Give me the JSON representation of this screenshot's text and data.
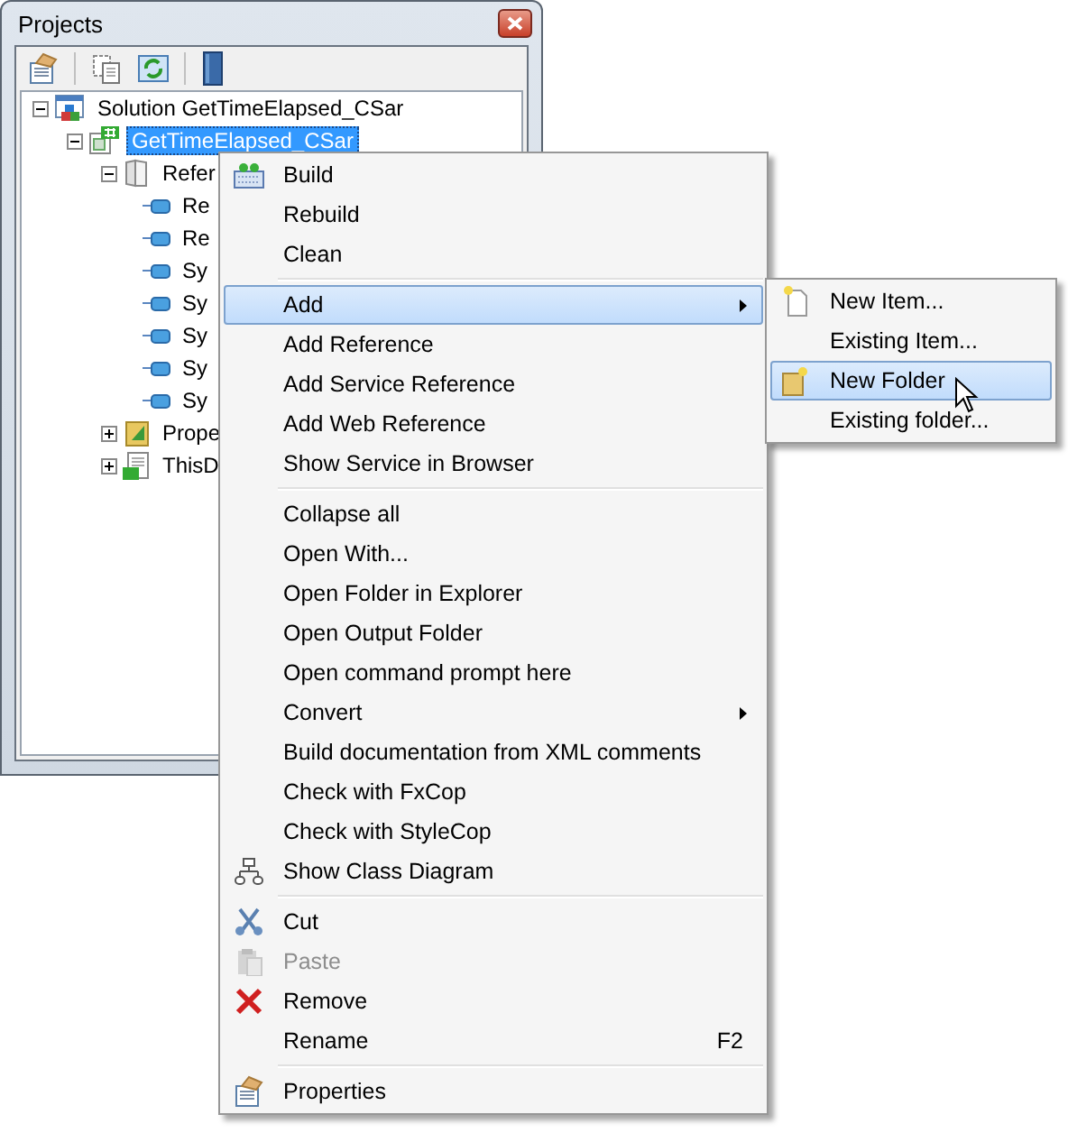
{
  "window": {
    "title": "Projects"
  },
  "tree": [
    {
      "label": "Solution GetTimeElapsed_CSar",
      "kind": "solution",
      "expanded": true,
      "selected": false,
      "children": [
        {
          "label": "GetTimeElapsed_CSar",
          "kind": "project",
          "expanded": true,
          "selected": true,
          "children": [
            {
              "label": "Refer",
              "kind": "references",
              "expanded": true,
              "selected": false,
              "children": [
                {
                  "label": "Re",
                  "kind": "reference",
                  "selected": false
                },
                {
                  "label": "Re",
                  "kind": "reference",
                  "selected": false
                },
                {
                  "label": "Sy",
                  "kind": "reference",
                  "selected": false
                },
                {
                  "label": "Sy",
                  "kind": "reference",
                  "selected": false
                },
                {
                  "label": "Sy",
                  "kind": "reference",
                  "selected": false
                },
                {
                  "label": "Sy",
                  "kind": "reference",
                  "selected": false
                },
                {
                  "label": "Sy",
                  "kind": "reference",
                  "selected": false
                }
              ]
            },
            {
              "label": "Prope",
              "kind": "properties",
              "expanded": false,
              "selected": false
            },
            {
              "label": "ThisD",
              "kind": "file",
              "expanded": false,
              "selected": false
            }
          ]
        }
      ]
    }
  ],
  "context_menu": {
    "items": [
      {
        "kind": "item",
        "label": "Build",
        "selected": false,
        "disabled": false,
        "submenu": false
      },
      {
        "kind": "item",
        "label": "Rebuild",
        "selected": false,
        "disabled": false,
        "submenu": false
      },
      {
        "kind": "item",
        "label": "Clean",
        "selected": false,
        "disabled": false,
        "submenu": false
      },
      {
        "kind": "separator"
      },
      {
        "kind": "item",
        "label": "Add",
        "selected": true,
        "disabled": false,
        "submenu": true
      },
      {
        "kind": "item",
        "label": "Add Reference",
        "selected": false,
        "disabled": false,
        "submenu": false
      },
      {
        "kind": "item",
        "label": "Add Service Reference",
        "selected": false,
        "disabled": false,
        "submenu": false
      },
      {
        "kind": "item",
        "label": "Add Web Reference",
        "selected": false,
        "disabled": false,
        "submenu": false
      },
      {
        "kind": "item",
        "label": "Show Service in Browser",
        "selected": false,
        "disabled": false,
        "submenu": false
      },
      {
        "kind": "separator"
      },
      {
        "kind": "item",
        "label": "Collapse all",
        "selected": false,
        "disabled": false,
        "submenu": false
      },
      {
        "kind": "item",
        "label": "Open With...",
        "selected": false,
        "disabled": false,
        "submenu": false
      },
      {
        "kind": "item",
        "label": "Open Folder in Explorer",
        "selected": false,
        "disabled": false,
        "submenu": false
      },
      {
        "kind": "item",
        "label": "Open Output Folder",
        "selected": false,
        "disabled": false,
        "submenu": false
      },
      {
        "kind": "item",
        "label": "Open command prompt here",
        "selected": false,
        "disabled": false,
        "submenu": false
      },
      {
        "kind": "item",
        "label": "Convert",
        "selected": false,
        "disabled": false,
        "submenu": true
      },
      {
        "kind": "item",
        "label": "Build documentation from XML comments",
        "selected": false,
        "disabled": false,
        "submenu": false
      },
      {
        "kind": "item",
        "label": "Check with FxCop",
        "selected": false,
        "disabled": false,
        "submenu": false
      },
      {
        "kind": "item",
        "label": "Check with StyleCop",
        "selected": false,
        "disabled": false,
        "submenu": false
      },
      {
        "kind": "item",
        "label": "Show Class Diagram",
        "selected": false,
        "disabled": false,
        "submenu": false
      },
      {
        "kind": "separator"
      },
      {
        "kind": "item",
        "label": "Cut",
        "selected": false,
        "disabled": false,
        "submenu": false
      },
      {
        "kind": "item",
        "label": "Paste",
        "selected": false,
        "disabled": true,
        "submenu": false
      },
      {
        "kind": "item",
        "label": "Remove",
        "selected": false,
        "disabled": false,
        "submenu": false
      },
      {
        "kind": "item",
        "label": "Rename",
        "shortcut": "F2",
        "selected": false,
        "disabled": false,
        "submenu": false
      },
      {
        "kind": "separator"
      },
      {
        "kind": "item",
        "label": "Properties",
        "selected": false,
        "disabled": false,
        "submenu": false
      }
    ]
  },
  "submenu": {
    "items": [
      {
        "label": "New Item...",
        "selected": false
      },
      {
        "label": "Existing Item...",
        "selected": false
      },
      {
        "label": "New Folder",
        "selected": true
      },
      {
        "label": "Existing folder...",
        "selected": false
      }
    ]
  }
}
